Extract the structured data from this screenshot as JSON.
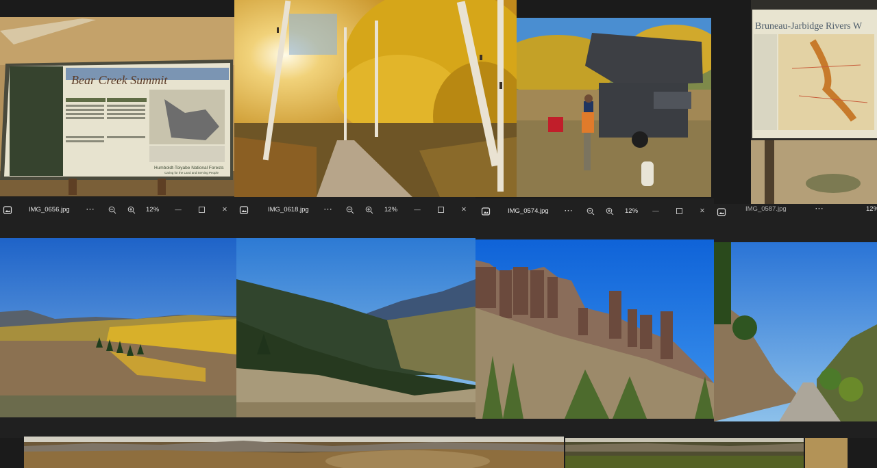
{
  "windows": [
    {
      "filename": "IMG_0656.jpg",
      "more": "···",
      "zoom": "12%",
      "icons": [
        "photo-app-icon",
        "zoom-out-icon",
        "zoom-in-icon",
        "minimize-icon",
        "maximize-icon",
        "close-icon"
      ]
    },
    {
      "filename": "IMG_0618.jpg",
      "more": "···",
      "zoom": "12%"
    },
    {
      "filename": "IMG_0574.jpg",
      "more": "···",
      "zoom": "12%"
    },
    {
      "filename": "IMG_0587.jpg",
      "more": "···",
      "zoom": "12%"
    }
  ],
  "photos": {
    "bear_creek_sign": {
      "title": "Bear Creek Summit",
      "subtitle": "Humboldt-Toiyabe National Forests",
      "sub2": "Caring for the Land and Serving People"
    },
    "bruneau_sign": {
      "title": "Bruneau-Jarbidge Rivers W"
    }
  },
  "window_controls": {
    "minimize": "—",
    "close": "✕"
  }
}
